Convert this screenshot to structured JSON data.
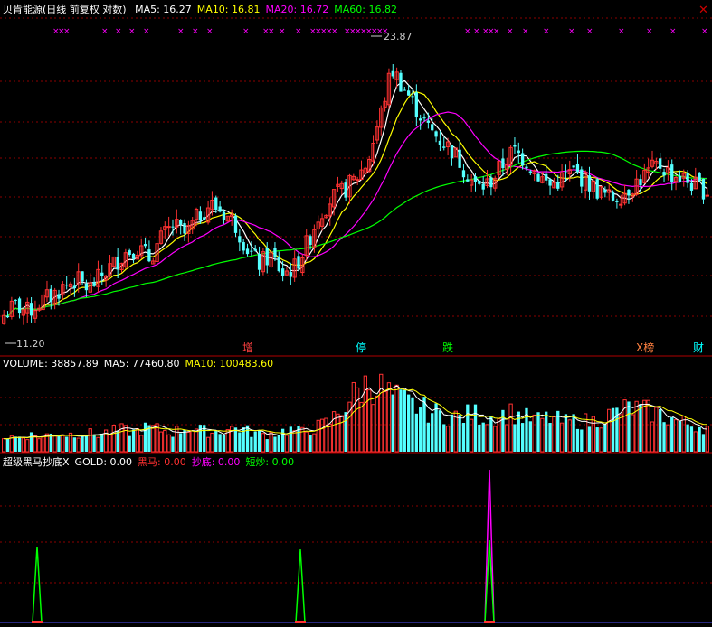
{
  "price_panel": {
    "stock_name": "贝肯能源",
    "period_label": "(日线 前复权 对数)",
    "indicators": [
      {
        "label": "MA5:",
        "value": "16.27",
        "color": "#ffffff"
      },
      {
        "label": "MA10:",
        "value": "16.81",
        "color": "#ffff00"
      },
      {
        "label": "MA20:",
        "value": "16.72",
        "color": "#ff00ff"
      },
      {
        "label": "MA60:",
        "value": "16.82",
        "color": "#00ff00"
      }
    ],
    "high_label": "23.87",
    "low_label": "11.20",
    "event_badges": [
      {
        "text": "增",
        "color": "#ff4040"
      },
      {
        "text": "停",
        "color": "#00ffff"
      },
      {
        "text": "跌",
        "color": "#00ff00"
      },
      {
        "text": "X榜",
        "color": "#ff8040"
      },
      {
        "text": "财",
        "color": "#00ffff"
      }
    ]
  },
  "volume_panel": {
    "indicators": [
      {
        "label": "VOLUME:",
        "value": "38857.89",
        "color": "#ffffff"
      },
      {
        "label": "MA5:",
        "value": "77460.80",
        "color": "#ffffff"
      },
      {
        "label": "MA10:",
        "value": "100483.60",
        "color": "#ffff00"
      }
    ]
  },
  "signal_panel": {
    "indicators": [
      {
        "label": "超级黑马抄底X",
        "value": "",
        "color": "#ffffff"
      },
      {
        "label": "GOLD:",
        "value": "0.00",
        "color": "#ffffff"
      },
      {
        "label": "黑马:",
        "value": "0.00",
        "color": "#ff3030"
      },
      {
        "label": "抄底:",
        "value": "0.00",
        "color": "#ff00ff"
      },
      {
        "label": "短炒:",
        "value": "0.00",
        "color": "#00ff00"
      }
    ]
  },
  "colors": {
    "up": "#ff3232",
    "down": "#54ffff",
    "ma5": "#ffffff",
    "ma10": "#ffff00",
    "ma20": "#ff00ff",
    "ma60": "#00ff00",
    "grid": "#8b0000",
    "marker": "#ff00ff"
  },
  "chart_data": {
    "type": "candlestick",
    "scale": "log",
    "ylim": [
      11.2,
      23.87
    ],
    "close_path": [
      12.0,
      12.3,
      12.1,
      12.4,
      12.6,
      12.9,
      13.1,
      12.8,
      13.2,
      13.6,
      14.0,
      14.2,
      13.8,
      14.5,
      15.0,
      14.6,
      15.3,
      15.8,
      15.5,
      15.1,
      14.2,
      13.6,
      13.9,
      13.3,
      13.5,
      14.3,
      15.4,
      16.0,
      16.3,
      16.8,
      17.5,
      19.5,
      22.0,
      21.0,
      20.0,
      19.0,
      18.5,
      18.0,
      17.2,
      16.4,
      16.6,
      17.3,
      18.0,
      17.6,
      17.0,
      16.5,
      16.8,
      17.1,
      16.7,
      16.3,
      16.0,
      16.2,
      16.6,
      17.0,
      17.4,
      17.0,
      16.8,
      16.5,
      16.3
    ],
    "volume_path": [
      3,
      3,
      3.5,
      3,
      4,
      3.5,
      4,
      3.5,
      4,
      4.5,
      4,
      5,
      4.5,
      4,
      5,
      4.5,
      4,
      4.5,
      5,
      4,
      3.5,
      4,
      4.5,
      4,
      5,
      6,
      9,
      12,
      14,
      13,
      11,
      10,
      9,
      8,
      7.5,
      7,
      8,
      7,
      7.5,
      8,
      7,
      6.5,
      7,
      6,
      6.5,
      6,
      7,
      8,
      9,
      8.5,
      8,
      7,
      6,
      5.5,
      5
    ]
  }
}
